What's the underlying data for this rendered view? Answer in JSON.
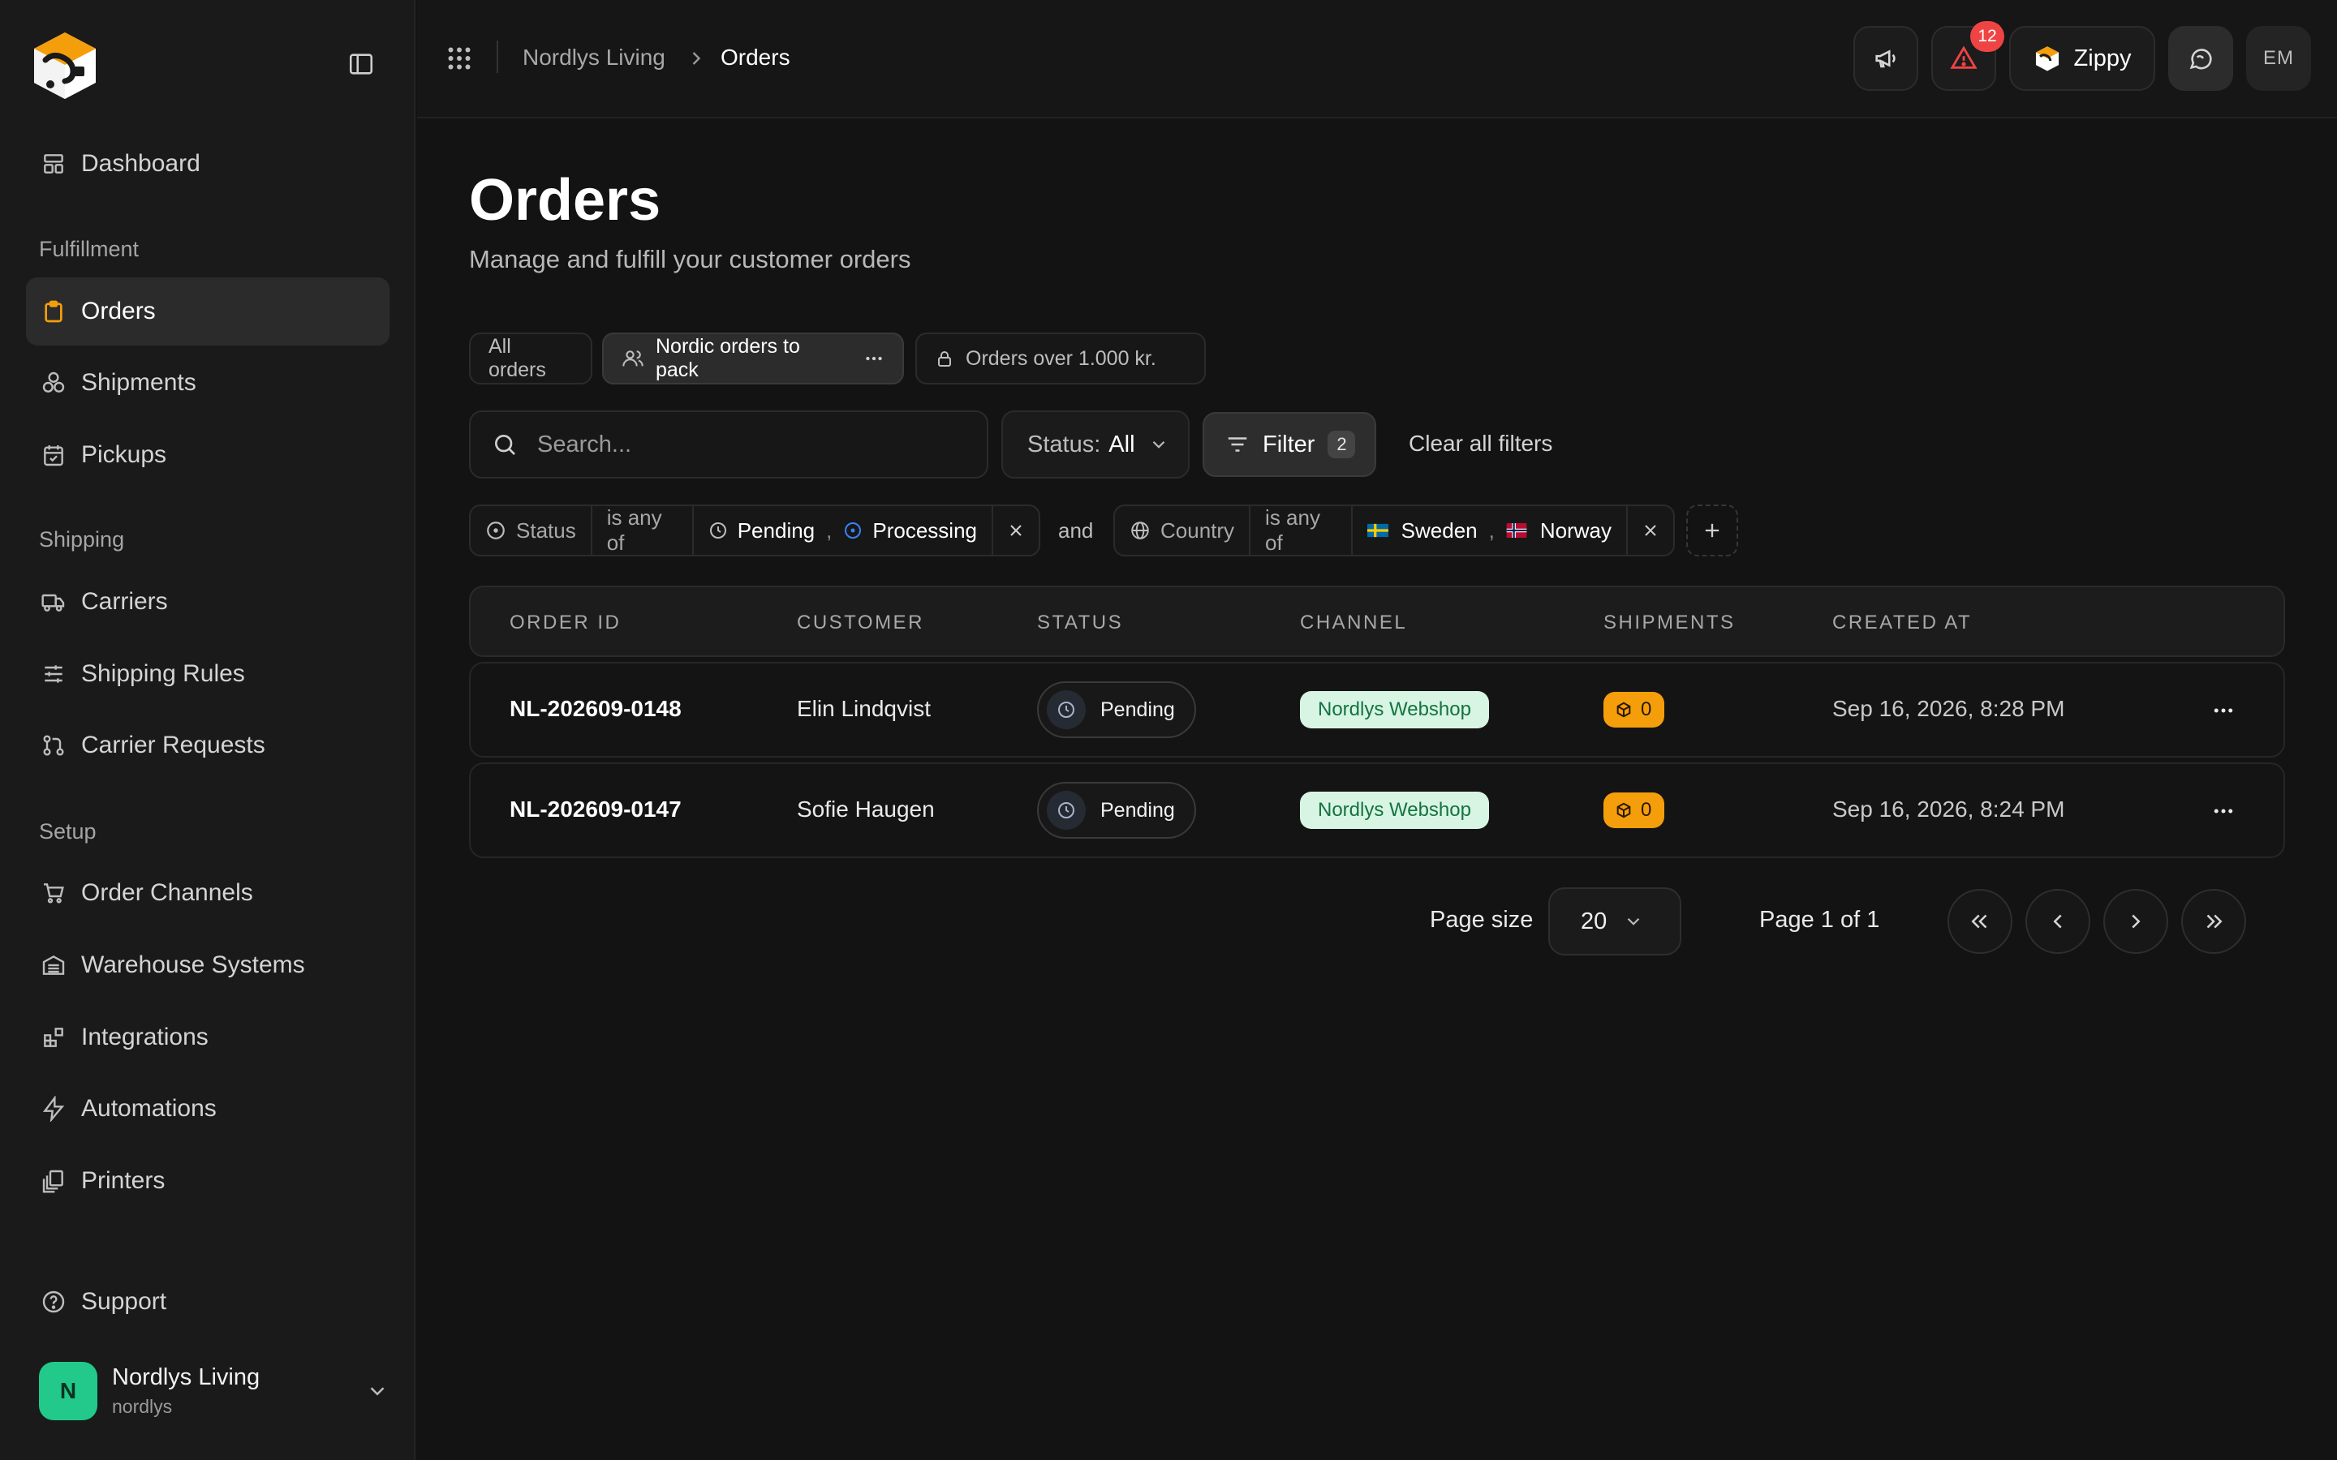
{
  "brand": {
    "accent": "#f59e0b",
    "success": "#22c98a"
  },
  "sidebar": {
    "dashboard": "Dashboard",
    "sections": {
      "fulfillment": "Fulfillment",
      "shipping": "Shipping",
      "setup": "Setup"
    },
    "items": {
      "orders": "Orders",
      "shipments": "Shipments",
      "pickups": "Pickups",
      "carriers": "Carriers",
      "shipping_rules": "Shipping Rules",
      "carrier_requests": "Carrier Requests",
      "order_channels": "Order Channels",
      "warehouse_systems": "Warehouse Systems",
      "integrations": "Integrations",
      "automations": "Automations",
      "printers": "Printers"
    },
    "support": "Support",
    "account": {
      "initial": "N",
      "name": "Nordlys Living",
      "handle": "nordlys"
    }
  },
  "header": {
    "breadcrumb": [
      "Nordlys Living",
      "Orders"
    ],
    "alerts_count": "12",
    "assistant_label": "Zippy",
    "user_initials": "EM"
  },
  "page": {
    "title": "Orders",
    "subtitle": "Manage and fulfill your customer orders"
  },
  "views": [
    "All orders",
    "Nordic orders to pack",
    "Orders over 1.000 kr."
  ],
  "toolbar": {
    "search_placeholder": "Search...",
    "status_label": "Status:",
    "status_value": "All",
    "filter_label": "Filter",
    "filter_count": "2",
    "clear_label": "Clear all filters"
  },
  "filters": {
    "status": {
      "field": "Status",
      "operator": "is any of",
      "values": [
        "Pending",
        "Processing"
      ]
    },
    "joiner": "and",
    "country": {
      "field": "Country",
      "operator": "is any of",
      "values": [
        "Sweden",
        "Norway"
      ]
    },
    "separator": ","
  },
  "table": {
    "headers": [
      "ORDER ID",
      "CUSTOMER",
      "STATUS",
      "CHANNEL",
      "SHIPMENTS",
      "CREATED AT"
    ],
    "rows": [
      {
        "order_id": "NL-202609-0148",
        "customer": "Elin Lindqvist",
        "status": "Pending",
        "channel": "Nordlys Webshop",
        "shipments": "0",
        "created_at": "Sep 16, 2026, 8:28 PM"
      },
      {
        "order_id": "NL-202609-0147",
        "customer": "Sofie Haugen",
        "status": "Pending",
        "channel": "Nordlys Webshop",
        "shipments": "0",
        "created_at": "Sep 16, 2026, 8:24 PM"
      }
    ]
  },
  "pagination": {
    "page_size_label": "Page size",
    "page_size": "20",
    "page_info": "Page 1 of 1"
  }
}
